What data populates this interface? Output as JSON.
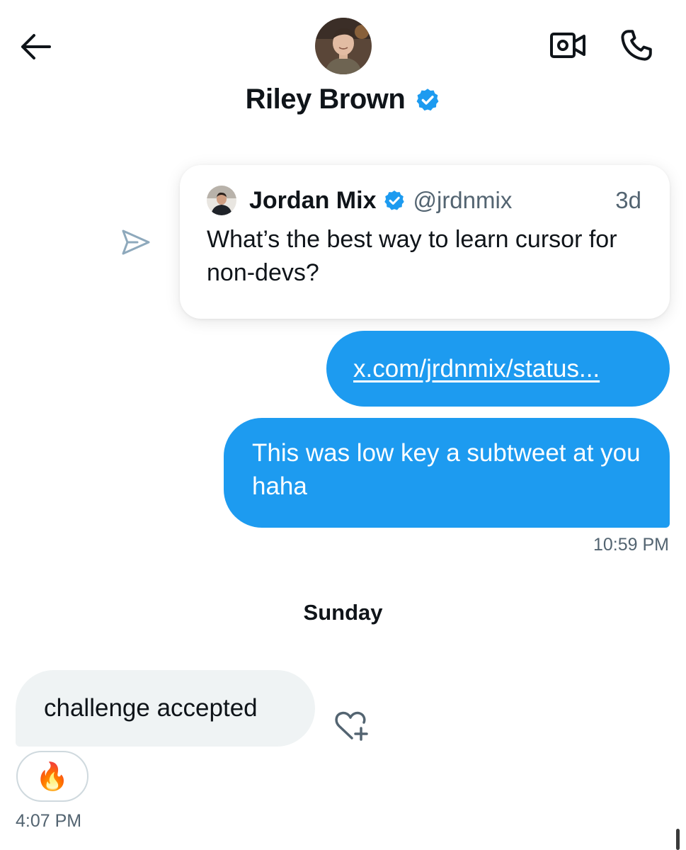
{
  "header": {
    "contact_name": "Riley Brown",
    "verified": true,
    "icons": {
      "back": "arrow-left-icon",
      "video": "video-camera-icon",
      "call": "phone-icon"
    }
  },
  "conversation": {
    "quoted_post": {
      "author_name": "Jordan Mix",
      "handle": "@jrdnmix",
      "age": "3d",
      "text": "What’s the best way to learn cursor for non-devs?",
      "share_icon": "send-icon"
    },
    "outgoing": [
      {
        "type": "link",
        "text": "x.com/jrdnmix/status..."
      },
      {
        "type": "text",
        "text": "This was low key a subtweet at you haha"
      }
    ],
    "outgoing_time": "10:59 PM",
    "day_separator": "Sunday",
    "incoming": {
      "text": "challenge accepted",
      "reaction": "🔥",
      "time": "4:07 PM",
      "add_reaction_icon": "heart-plus-icon"
    }
  },
  "colors": {
    "accent": "#1d9bf0",
    "incoming_bubble": "#eff3f4",
    "secondary_text": "#536471",
    "primary_text": "#0f1419"
  }
}
